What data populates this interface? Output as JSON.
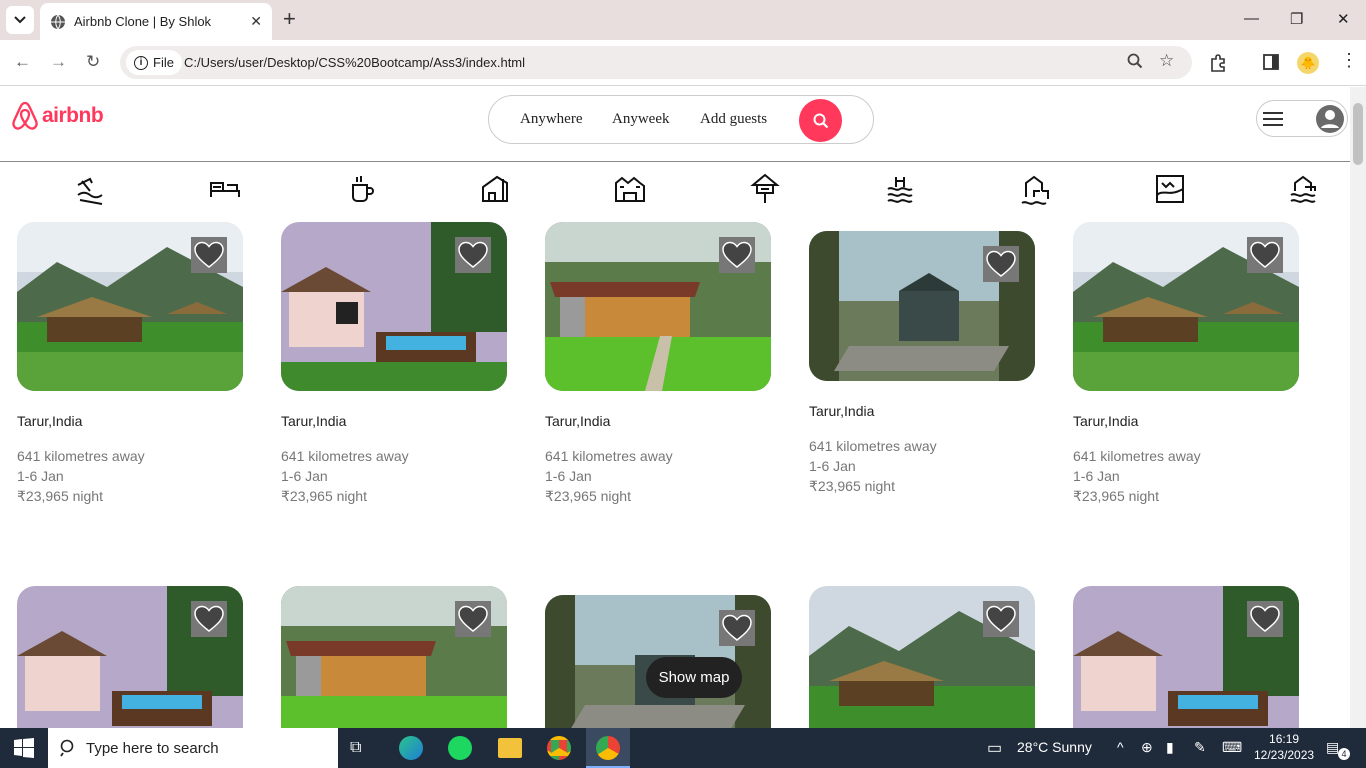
{
  "browser": {
    "tab_title": "Airbnb Clone | By Shlok",
    "file_label": "File",
    "url": "C:/Users/user/Desktop/CSS%20Bootcamp/Ass3/index.html"
  },
  "header": {
    "logo_text": "airbnb",
    "search": {
      "anywhere": "Anywhere",
      "anyweek": "Anyweek",
      "guests": "Add guests"
    }
  },
  "categories": [
    "beach-icon",
    "bed-icon",
    "coffee-icon",
    "house-icon",
    "farm-house-icon",
    "treehouse-icon",
    "lake-icon",
    "mansion-icon",
    "countryside-icon",
    "skyline-icon"
  ],
  "listings": [
    {
      "location": "Tarur,India",
      "distance": "641 kilometres away",
      "dates": "1-6 Jan",
      "price": "₹23,965 night"
    },
    {
      "location": "Tarur,India",
      "distance": "641 kilometres away",
      "dates": "1-6 Jan",
      "price": "₹23,965 night"
    },
    {
      "location": "Tarur,India",
      "distance": "641 kilometres away",
      "dates": "1-6 Jan",
      "price": "₹23,965 night"
    },
    {
      "location": "Tarur,India",
      "distance": "641 kilometres away",
      "dates": "1-6 Jan",
      "price": "₹23,965 night"
    },
    {
      "location": "Tarur,India",
      "distance": "641 kilometres away",
      "dates": "1-6 Jan",
      "price": "₹23,965 night"
    }
  ],
  "show_map": "Show map",
  "taskbar": {
    "search_placeholder": "Type here to search",
    "weather": "28°C  Sunny",
    "time": "16:19",
    "date": "12/23/2023",
    "notifications": "4"
  },
  "colors": {
    "brand": "#ff385c"
  }
}
